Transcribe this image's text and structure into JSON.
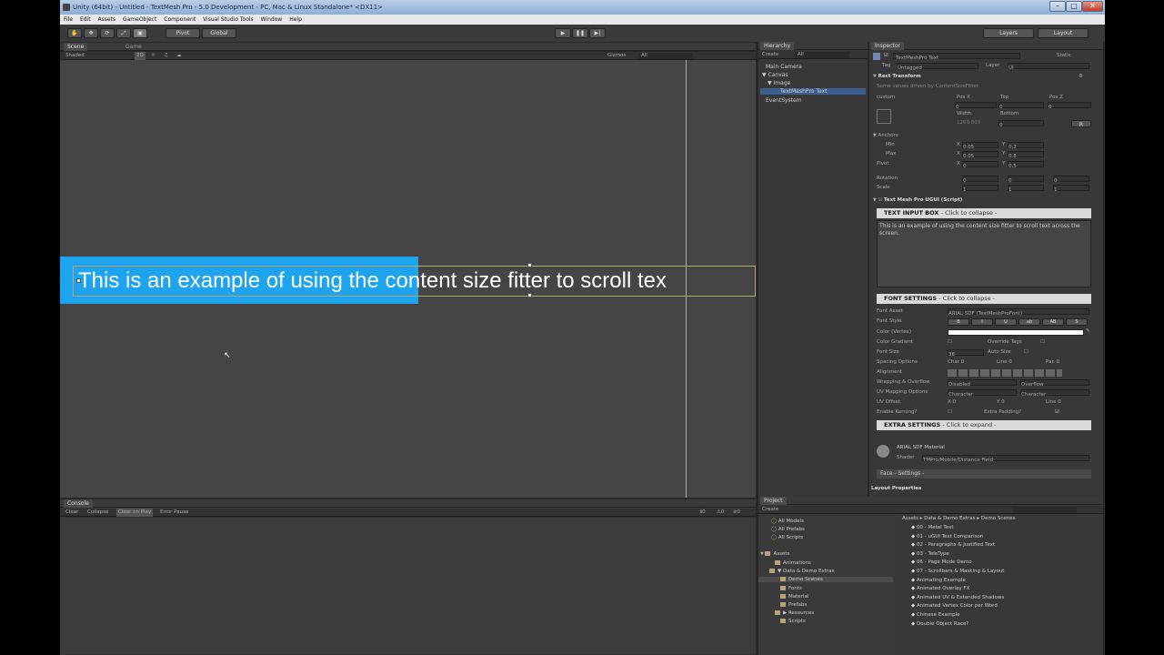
{
  "window": {
    "title": "Unity (64bit) - Untitled - TextMesh Pro - 5.0 Development - PC, Mac & Linux Standalone* <DX11>",
    "min_label": "–",
    "max_label": "□",
    "close_label": "✕"
  },
  "menu": [
    "File",
    "Edit",
    "Assets",
    "GameObject",
    "Component",
    "Visual Studio Tools",
    "Window",
    "Help"
  ],
  "toolbar": {
    "pivot": "Pivot",
    "global": "Global",
    "layers": "Layers",
    "layout": "Layout",
    "play": "▶",
    "pause": "❚❚",
    "step": "▶|"
  },
  "scene": {
    "tab_scene": "Scene",
    "tab_game": "Game",
    "shading": "Shaded",
    "mode_2d": "2D",
    "gizmos": "Gizmos",
    "search": "All",
    "text": "This is an example of using the content size fitter to scroll tex"
  },
  "hierarchy": {
    "tab": "Hierarchy",
    "create": "Create",
    "search": "All",
    "items": [
      {
        "label": "Main Camera",
        "indent": 0,
        "selected": false
      },
      {
        "label": "▼ Canvas",
        "indent": 0,
        "selected": false
      },
      {
        "label": "▼ Image",
        "indent": 1,
        "selected": false
      },
      {
        "label": "TextMeshPro Text",
        "indent": 2,
        "selected": true
      },
      {
        "label": "EventSystem",
        "indent": 0,
        "selected": false
      }
    ]
  },
  "inspector": {
    "tab": "Inspector",
    "object_name": "TextMeshPro Text",
    "static": "Static",
    "tag_label": "Tag",
    "tag_value": "Untagged",
    "layer_label": "Layer",
    "layer_value": "UI",
    "rect_transform": "Rect Transform",
    "rect_note": "Some values driven by ContentSizeFitter.",
    "custom": "custom",
    "pos_x_label": "Pos X",
    "top_label": "Top",
    "pos_z_label": "Pos Z",
    "pos_x": "0",
    "top": "0",
    "pos_z": "0",
    "width_label": "Width",
    "bottom_label": "Bottom",
    "width": "1200.803",
    "bottom": "0",
    "anchors": "Anchors",
    "min_label": "Min",
    "max_label": "Max",
    "min_x": "0.05",
    "min_y": "0.2",
    "max_x": "0.05",
    "max_y": "0.8",
    "pivot_label": "Pivot",
    "pivot_x": "0",
    "pivot_y": "0.5",
    "rotation_label": "Rotation",
    "rot_x": "0",
    "rot_y": "0",
    "rot_z": "0",
    "scale_label": "Scale",
    "scale_x": "1",
    "scale_y": "1",
    "scale_z": "1",
    "script_title": "Text Mesh Pro UGUI (Script)",
    "text_input": "TEXT INPUT BOX",
    "collapse": "- Click to collapse -",
    "text_value": "This is an example of using the content size fitter to scroll text across the screen.",
    "font_settings": "FONT SETTINGS",
    "font_asset_label": "Font Asset",
    "font_asset": "ARIAL SDF (TextMeshProFont)",
    "font_style_label": "Font Style",
    "font_style_buttons": [
      "B",
      "I",
      "U",
      "ab",
      "AB",
      "S"
    ],
    "color_label": "Color (Vertex)",
    "gradient_label": "Color Gradient",
    "override_label": "Override Tags",
    "font_size_label": "Font Size",
    "font_size": "36",
    "auto_size_label": "Auto Size",
    "spacing_label": "Spacing Options",
    "char_label": "Char",
    "char_value": "0",
    "line_label": "Line",
    "line_value": "0",
    "par_label": "Par.",
    "par_value": "0",
    "alignment_label": "Alignment",
    "wrapping_label": "Wrapping & Overflow",
    "wrapping_value": "Disabled",
    "overflow_value": "Overflow",
    "uv_label": "UV Mapping Options",
    "uv_h": "Character",
    "uv_v": "Character",
    "uv_offset_label": "UV Offset",
    "uv_x": "0",
    "uv_y": "0",
    "uv_line_label": "Line",
    "uv_line": "0",
    "kerning_label": "Enable Kerning?",
    "padding_label": "Extra Padding?",
    "extra_settings": "EXTRA SETTINGS",
    "expand": "- Click to expand -",
    "material": "ARIAL SDF Material",
    "shader_label": "Shader",
    "shader_value": "TMPro/Mobile/Distance Field",
    "face_label": "Face - Settings -",
    "layout_props": "Layout Properties"
  },
  "console": {
    "tab": "Console",
    "buttons": [
      "Clear",
      "Collapse",
      "Clear on Play",
      "Error Pause"
    ]
  },
  "project": {
    "tab": "Project",
    "create": "Create",
    "favorites": [
      "All Models",
      "All Prefabs",
      "All Scripts"
    ],
    "tree_root": "Assets",
    "tree": [
      {
        "label": "Animations",
        "indent": 1,
        "selected": false
      },
      {
        "label": "▼ Data & Demo Extras",
        "indent": 1,
        "selected": false
      },
      {
        "label": "Demo Scenes",
        "indent": 2,
        "selected": true
      },
      {
        "label": "Fonts",
        "indent": 2,
        "selected": false
      },
      {
        "label": "Material",
        "indent": 2,
        "selected": false
      },
      {
        "label": "Prefabs",
        "indent": 2,
        "selected": false
      },
      {
        "label": "▶ Resources",
        "indent": 2,
        "selected": false
      },
      {
        "label": "Scripts",
        "indent": 2,
        "selected": false
      }
    ],
    "breadcrumb": "Assets ▸ Data & Demo Extras ▸ Demo Scenes",
    "files": [
      "00 - Metal Text",
      "01 - uGUI Text Comparison",
      "02 - Paragraphs & Justified Text",
      "03 - TeleType",
      "06 - Page Mode Demo",
      "07 - Scrollbars & Masking & Layout",
      "Animating Example",
      "Animated Overlay FX",
      "Animated UV & Extended Shadows",
      "Animated Vertex Color per Word",
      "Chinese Example",
      "Double Object Race?"
    ]
  }
}
